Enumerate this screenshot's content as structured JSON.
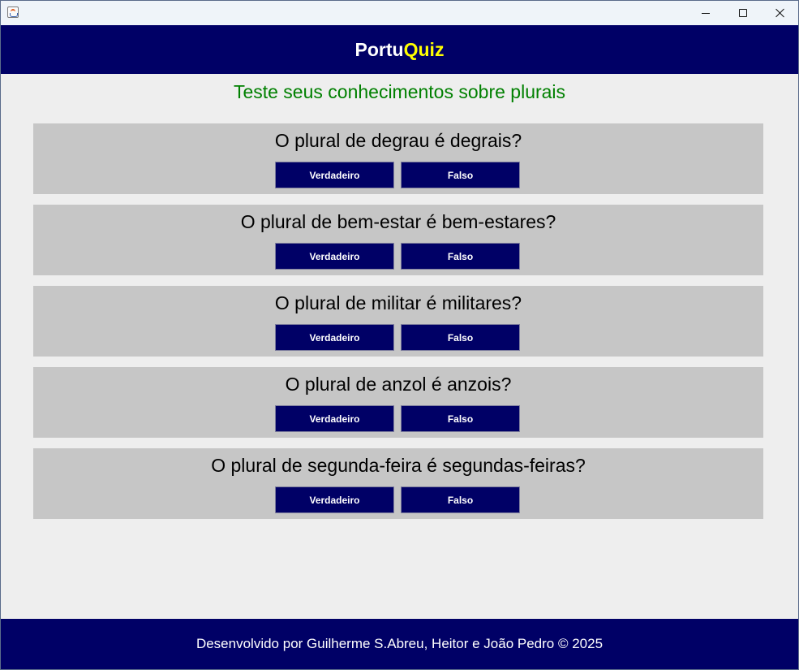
{
  "window": {
    "controls": [
      "minimize-icon",
      "maximize-icon",
      "close-icon"
    ]
  },
  "header": {
    "title_part1": "Portu",
    "title_part2": "Quiz"
  },
  "subtitle": "Teste seus conhecimentos sobre plurais",
  "questions": [
    {
      "text": "O plural de degrau é degrais?",
      "true_label": "Verdadeiro",
      "false_label": "Falso"
    },
    {
      "text": "O plural de bem-estar é bem-estares?",
      "true_label": "Verdadeiro",
      "false_label": "Falso"
    },
    {
      "text": "O plural de militar é militares?",
      "true_label": "Verdadeiro",
      "false_label": "Falso"
    },
    {
      "text": "O plural de anzol é anzois?",
      "true_label": "Verdadeiro",
      "false_label": "Falso"
    },
    {
      "text": "O plural de segunda-feira é segundas-feiras?",
      "true_label": "Verdadeiro",
      "false_label": "Falso"
    }
  ],
  "footer": {
    "credits": "Desenvolvido por Guilherme S.Abreu, Heitor e João Pedro © 2025"
  },
  "colors": {
    "brand_navy": "#000066",
    "title_accent": "#ffff00",
    "subtitle_green": "#008000",
    "card_gray": "#c6c6c6",
    "content_bg": "#eeeeee"
  }
}
